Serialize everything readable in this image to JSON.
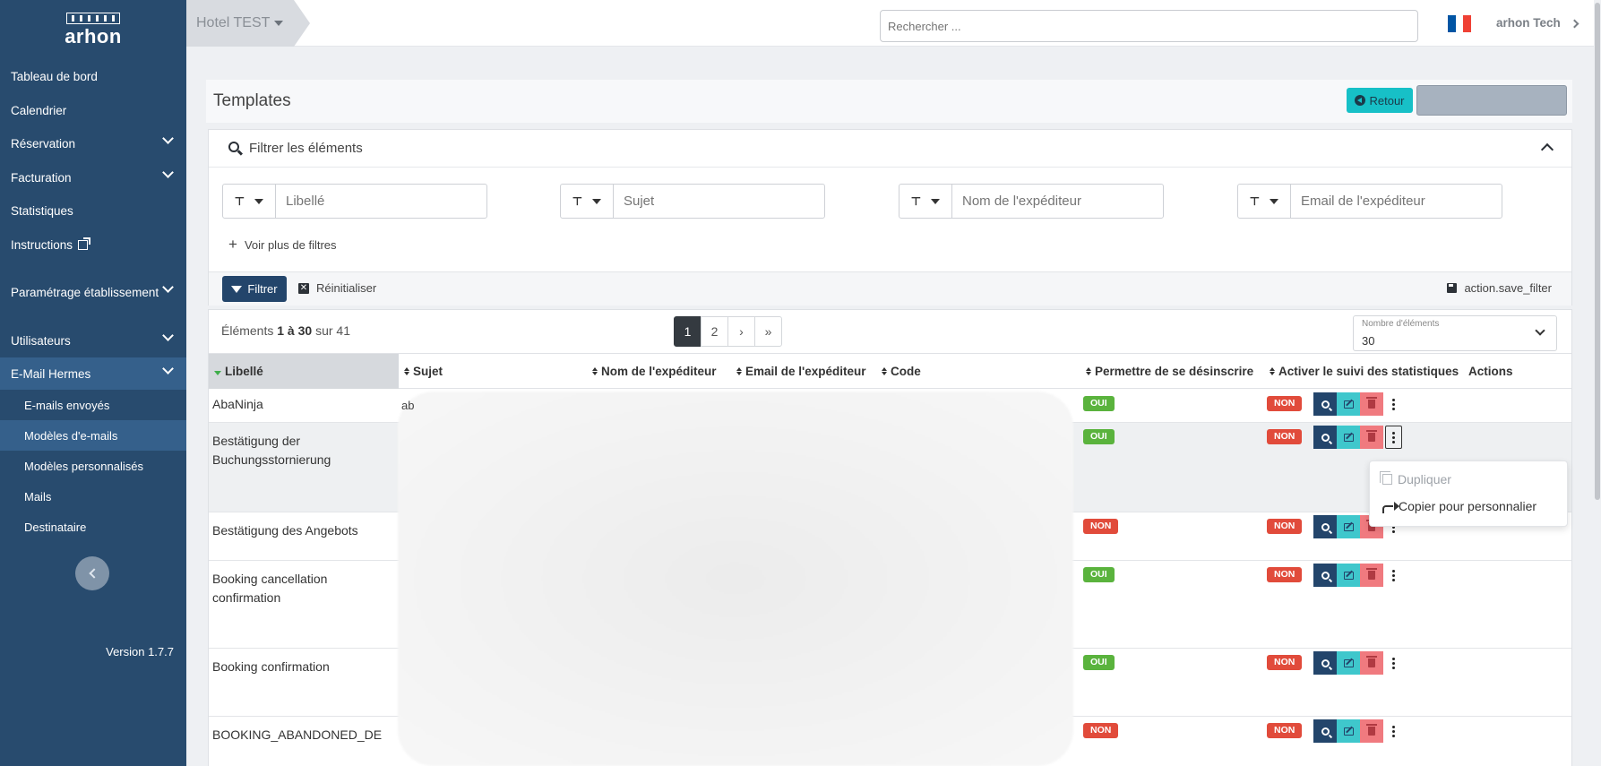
{
  "app": {
    "logo_text": "arhon",
    "version": "Version 1.7.7"
  },
  "sidebar": {
    "items": [
      {
        "label": "Tableau de bord"
      },
      {
        "label": "Calendrier"
      },
      {
        "label": "Réservation"
      },
      {
        "label": "Facturation"
      },
      {
        "label": "Statistiques"
      },
      {
        "label": "Instructions"
      },
      {
        "label": "Paramétrage établissement"
      },
      {
        "label": "Utilisateurs"
      },
      {
        "label": "E-Mail Hermes"
      }
    ],
    "subitems": [
      {
        "label": "E-mails envoyés"
      },
      {
        "label": "Modèles d'e-mails"
      },
      {
        "label": "Modèles personnalisés"
      },
      {
        "label": "Mails"
      },
      {
        "label": "Destinataire"
      }
    ]
  },
  "topbar": {
    "hotel": "Hotel TEST",
    "search_placeholder": "Rechercher ...",
    "user": "arhon Tech",
    "flag_colors": [
      "#0055a4",
      "#ffffff",
      "#ef4135"
    ]
  },
  "page": {
    "title": "Templates",
    "retour_label": "Retour"
  },
  "filters": {
    "header": "Filtrer les éléments",
    "fields": [
      "Libellé",
      "Sujet",
      "Nom de l'expéditeur",
      "Email de l'expéditeur"
    ],
    "more": "Voir plus de filtres",
    "filter_btn": "Filtrer",
    "reset_btn": "Réinitialiser",
    "save_btn": "action.save_filter"
  },
  "table": {
    "count_prefix": "Éléments ",
    "count_range": "1 à 30",
    "count_suffix": " sur 41",
    "pages": [
      "1",
      "2"
    ],
    "page_size_label": "Nombre d'éléments",
    "page_size": "30",
    "columns": [
      "Libellé",
      "Sujet",
      "Nom de l'expéditeur",
      "Email de l'expéditeur",
      "Code",
      "Permettre de se désinscrire",
      "Activer le suivi des statistiques",
      "Actions"
    ],
    "rows": [
      {
        "libelle": "AbaNinja",
        "desinscrire": "OUI",
        "stats": "NON"
      },
      {
        "libelle": "Bestätigung der Buchungsstornierung",
        "desinscrire": "OUI",
        "stats": "NON"
      },
      {
        "libelle": "Bestätigung des Angebots",
        "desinscrire": "NON",
        "stats": "NON"
      },
      {
        "libelle": "Booking cancellation confirmation",
        "desinscrire": "OUI",
        "stats": "NON"
      },
      {
        "libelle": "Booking confirmation",
        "desinscrire": "OUI",
        "stats": "NON"
      },
      {
        "libelle": "BOOKING_ABANDONED_DE",
        "desinscrire": "NON",
        "stats": "NON"
      }
    ],
    "first_row_subject_fragment": "ab"
  },
  "dropdown": {
    "items": [
      "Dupliquer",
      "Copier pour personnalier"
    ]
  }
}
